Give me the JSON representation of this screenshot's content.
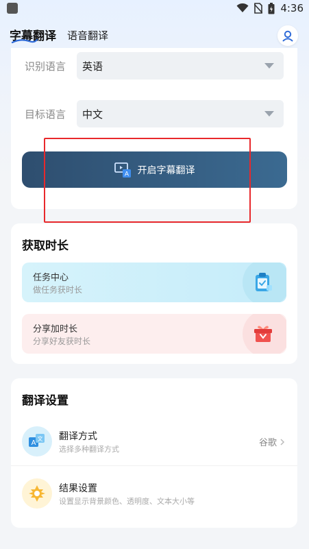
{
  "status_bar": {
    "time": "4:36",
    "icons": [
      "wifi-icon",
      "no-sim-icon",
      "battery-icon"
    ]
  },
  "header": {
    "tabs": [
      {
        "label": "字幕翻译",
        "active": true
      },
      {
        "label": "语音翻译",
        "active": false
      }
    ],
    "profile_icon": "user-icon"
  },
  "language_card": {
    "source": {
      "label": "识别语言",
      "value": "英语"
    },
    "target": {
      "label": "目标语言",
      "value": "中文"
    },
    "start_button": "开启字幕翻译"
  },
  "time_card": {
    "title": "获取时长",
    "items": [
      {
        "title": "任务中心",
        "subtitle": "做任务获时长",
        "icon": "clipboard-check-icon"
      },
      {
        "title": "分享加时长",
        "subtitle": "分享好友获时长",
        "icon": "gift-icon"
      }
    ]
  },
  "settings_card": {
    "title": "翻译设置",
    "items": [
      {
        "title": "翻译方式",
        "subtitle": "选择多种翻译方式",
        "value": "谷歌",
        "icon": "translate-icon"
      },
      {
        "title": "结果设置",
        "subtitle": "设置显示背景颜色、透明度、文本大小等",
        "icon": "settings-target-icon"
      }
    ]
  },
  "colors": {
    "primary_button": "#2e4e6f",
    "highlight": "#e8282b",
    "task_blue": "#c5ecfa",
    "task_pink": "#fdeeee"
  }
}
